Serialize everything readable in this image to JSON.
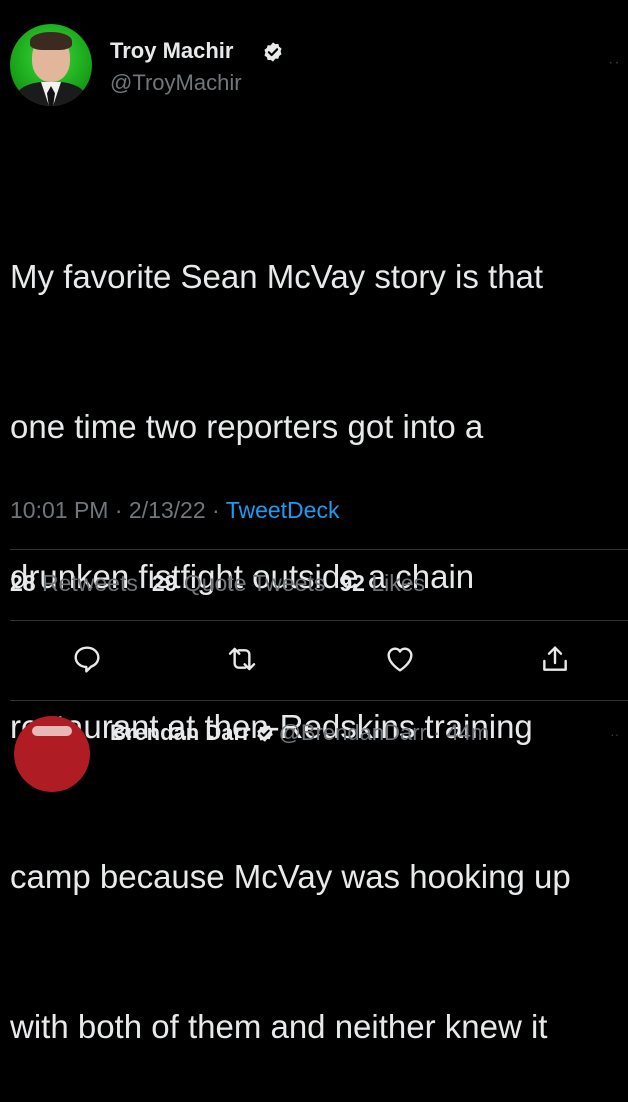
{
  "tweet": {
    "author_name": "Troy Machir",
    "author_handle": "@TroyMachir",
    "text_lines": [
      "My favorite Sean McVay story is that",
      "one time two reporters got into a",
      "drunken fistfight outside a chain",
      "restaurant at then-Redskins training",
      "camp because McVay was hooking up",
      "with both of them and neither knew it"
    ],
    "time": "10:01 PM",
    "date": "2/13/22",
    "source": "TweetDeck",
    "separator": " · "
  },
  "stats": {
    "retweets_count": "28",
    "retweets_label": "Retweets",
    "quotes_count": "29",
    "quotes_label": "Quote Tweets",
    "likes_count": "92",
    "likes_label": "Likes"
  },
  "actions": [
    "reply-icon",
    "retweet-icon",
    "like-icon",
    "share-icon"
  ],
  "reply_preview": {
    "author_name": "Brendan Darr",
    "author_handle": "@BrendanDarr",
    "time": "44m",
    "separator": " · "
  },
  "colors": {
    "background": "#000000",
    "primary_text": "#e7e9ea",
    "secondary_text": "#71767b",
    "accent": "#1d9bf0",
    "divider": "#2f3336",
    "avatar_green": "#1aa51a"
  }
}
